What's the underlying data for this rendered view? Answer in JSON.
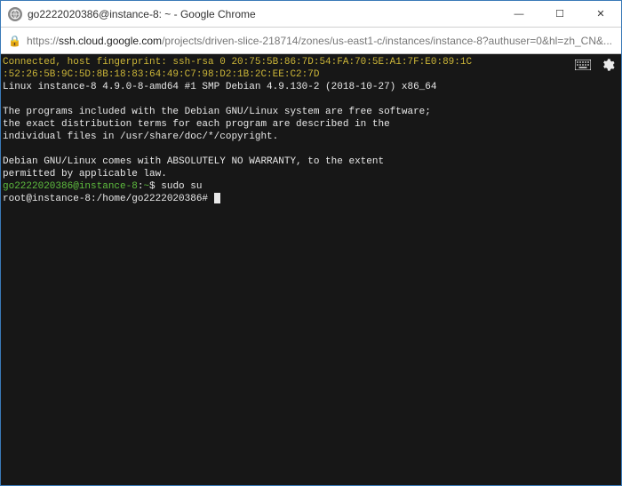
{
  "window": {
    "title": "go2222020386@instance-8: ~ - Google Chrome",
    "favicon_char": "🌐"
  },
  "address": {
    "scheme": "https://",
    "host": "ssh.cloud.google.com",
    "path": "/projects/driven-slice-218714/zones/us-east1-c/instances/instance-8?authuser=0&hl=zh_CN&..."
  },
  "terminal": {
    "fp_line1": "Connected, host fingerprint: ssh-rsa 0 20:75:5B:86:7D:54:FA:70:5E:A1:7F:E0:89:1C",
    "fp_line2": ":52:26:5B:9C:5D:8B:18:83:64:49:C7:98:D2:1B:2C:EE:C2:7D",
    "kernel": "Linux instance-8 4.9.0-8-amd64 #1 SMP Debian 4.9.130-2 (2018-10-27) x86_64",
    "msg1": "The programs included with the Debian GNU/Linux system are free software;",
    "msg2": "the exact distribution terms for each program are described in the",
    "msg3": "individual files in /usr/share/doc/*/copyright.",
    "msg4": "Debian GNU/Linux comes with ABSOLUTELY NO WARRANTY, to the extent",
    "msg5": "permitted by applicable law.",
    "prompt1_user": "go2222020386@instance-8",
    "prompt1_sep": ":",
    "prompt1_path": "~",
    "prompt1_sym": "$ ",
    "cmd1": "sudo su",
    "prompt2": "root@instance-8:/home/go2222020386# "
  }
}
